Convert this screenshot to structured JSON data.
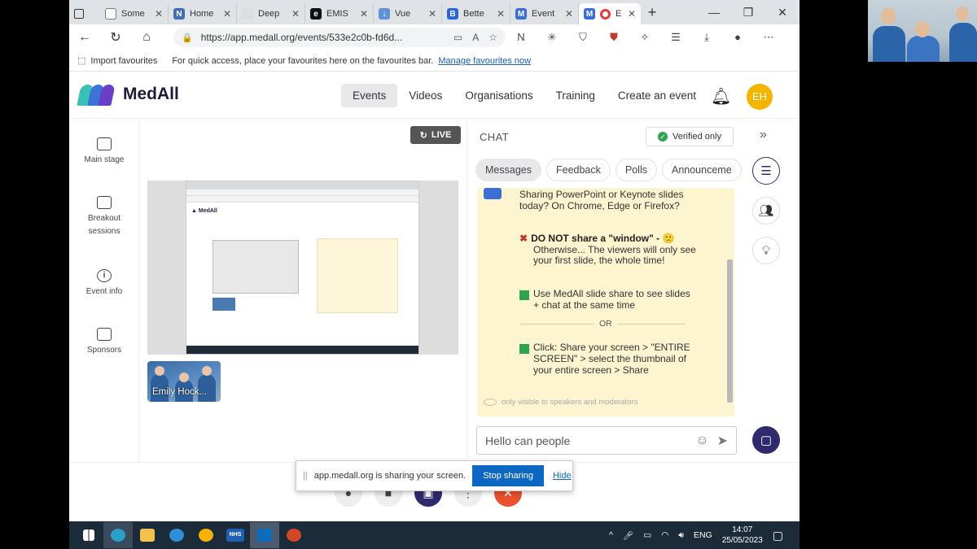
{
  "browser": {
    "tabs": [
      {
        "label": "Some",
        "icon": "page-icon",
        "color": "#ffffff"
      },
      {
        "label": "Home",
        "icon": "n-icon",
        "color": "#3f6fb6"
      },
      {
        "label": "Deep",
        "icon": "blank-icon",
        "color": "#dddddd"
      },
      {
        "label": "EMIS",
        "icon": "e-icon",
        "color": "#111111"
      },
      {
        "label": "Vue",
        "icon": "vue-icon",
        "color": "#5f93d6"
      },
      {
        "label": "Bette",
        "icon": "b-icon",
        "color": "#2b63d9"
      },
      {
        "label": "Event",
        "icon": "medall-icon",
        "color": "#3b6fd6"
      },
      {
        "label": "E",
        "icon": "record-icon",
        "color": "#e23b3b",
        "active": true
      }
    ],
    "new_tab": "+",
    "window_controls": [
      "—",
      "❐",
      "✕"
    ],
    "url": "https://app.medall.org/events/533e2c0b-fd6d...",
    "favourites": {
      "import_label": "Import favourites",
      "prompt": "For quick access, place your favourites here on the favourites bar.",
      "manage_link": "Manage favourites now"
    }
  },
  "app": {
    "brand": "MedAll",
    "brand_colors": [
      "#39c1b6",
      "#3b74d6",
      "#6a3fc8"
    ],
    "nav": [
      "Events",
      "Videos",
      "Organisations",
      "Training",
      "Create an event"
    ],
    "active_nav": "Events",
    "avatar_initials": "EH",
    "avatar_color": "#f5b400"
  },
  "rail": [
    {
      "label": "Main stage",
      "icon": "monitor-icon"
    },
    {
      "label": "Breakout sessions",
      "icon": "calendar-icon"
    },
    {
      "label": "Event info",
      "icon": "info-icon"
    },
    {
      "label": "Sponsors",
      "icon": "calendar-icon"
    }
  ],
  "stage": {
    "live_label": "LIVE",
    "camera_label": "Emily Hock..."
  },
  "chat": {
    "title": "CHAT",
    "verified_label": "Verified only",
    "tabs": [
      "Messages",
      "Feedback",
      "Polls",
      "Announceme"
    ],
    "active_tab": "Messages",
    "messages": {
      "intro": "Sharing PowerPoint or Keynote slides today? On Chrome, Edge or Firefox?",
      "warn_title": "DO NOT share a \"window\" - 🙁",
      "warn_body": "Otherwise... The viewers will only see your first slide, the whole time!",
      "tip1": "Use MedAll slide share to see slides + chat at the same time",
      "or": "OR",
      "tip2": "Click: Share your screen > \"ENTIRE SCREEN\" > select the thumbnail of your entire screen > Share"
    },
    "visibility_note": "only visible to speakers and moderators",
    "input_value": "Hello can people"
  },
  "share_bar": {
    "text": "app.medall.org is sharing your screen.",
    "stop_label": "Stop sharing",
    "hide_label": "Hide"
  },
  "taskbar": {
    "lang": "ENG",
    "time": "14:07",
    "date": "25/05/2023",
    "nhs_label": "NHS"
  }
}
